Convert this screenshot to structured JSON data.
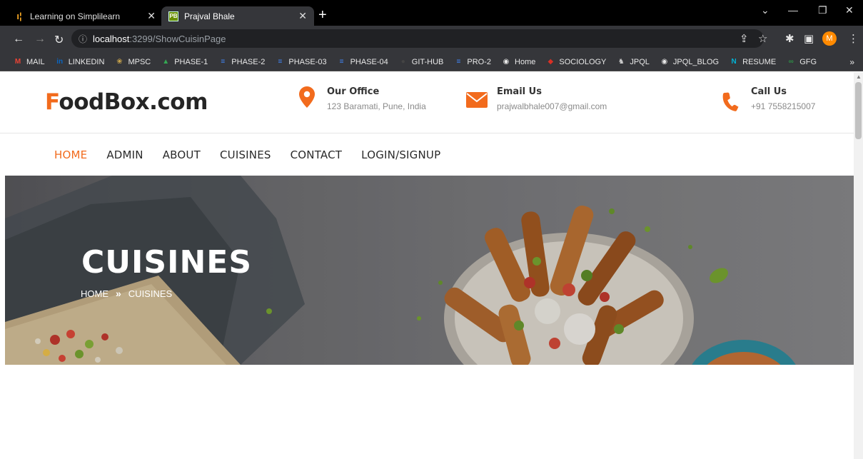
{
  "browser": {
    "tabs": [
      {
        "title": "Learning on Simplilearn",
        "active": false
      },
      {
        "title": "Prajval Bhale",
        "active": true
      }
    ],
    "tab_favicon_pb": "PB",
    "address": {
      "host": "localhost",
      "path": ":3299/ShowCuisinPage"
    },
    "avatar_letter": "M",
    "bookmarks": [
      {
        "label": "MAIL",
        "icon": "gmail-icon",
        "color": "#ea4335",
        "glyph": "M"
      },
      {
        "label": "LINKEDIN",
        "icon": "linkedin-icon",
        "color": "#0a66c2",
        "glyph": "in"
      },
      {
        "label": "MPSC",
        "icon": "emblem-icon",
        "color": "#c9a44c",
        "glyph": "❀"
      },
      {
        "label": "PHASE-1",
        "icon": "drive-icon",
        "color": "#34a853",
        "glyph": "▲"
      },
      {
        "label": "PHASE-2",
        "icon": "docs-icon",
        "color": "#4285f4",
        "glyph": "≡"
      },
      {
        "label": "PHASE-03",
        "icon": "docs-icon",
        "color": "#4285f4",
        "glyph": "≡"
      },
      {
        "label": "PHASE-04",
        "icon": "docs-icon",
        "color": "#4285f4",
        "glyph": "≡"
      },
      {
        "label": "GIT-HUB",
        "icon": "github-icon",
        "color": "#444",
        "glyph": "●"
      },
      {
        "label": "PRO-2",
        "icon": "docs-icon",
        "color": "#4285f4",
        "glyph": "≡"
      },
      {
        "label": "Home",
        "icon": "globe-icon",
        "color": "#e8e8e8",
        "glyph": "◉"
      },
      {
        "label": "SOCIOLOGY",
        "icon": "sociology-icon",
        "color": "#d93025",
        "glyph": "◆"
      },
      {
        "label": "JPQL",
        "icon": "jpql-icon",
        "color": "#ccc",
        "glyph": "♞"
      },
      {
        "label": "JPQL_BLOG",
        "icon": "globe-icon",
        "color": "#e8e8e8",
        "glyph": "◉"
      },
      {
        "label": "RESUME",
        "icon": "resume-icon",
        "color": "#00b4d8",
        "glyph": "N"
      },
      {
        "label": "GFG",
        "icon": "gfg-icon",
        "color": "#2f8d46",
        "glyph": "∞"
      }
    ],
    "bookmarks_more": "»"
  },
  "site": {
    "brand_first": "F",
    "brand_rest": "oodBox.com",
    "office": {
      "title": "Our Office",
      "value": "123 Baramati, Pune, India"
    },
    "email": {
      "title": "Email Us",
      "value": "prajwalbhale007@gmail.com"
    },
    "call": {
      "title": "Call Us",
      "value": "+91 7558215007"
    },
    "nav": [
      "HOME",
      "ADMIN",
      "ABOUT",
      "CUISINES",
      "CONTACT",
      "LOGIN/SIGNUP"
    ],
    "hero": {
      "title": "CUISINES",
      "crumb_home": "HOME",
      "crumb_sep": "»",
      "crumb_current": "CUISINES"
    }
  },
  "colors": {
    "accent": "#f26b1d",
    "brand_dark": "#252525"
  }
}
